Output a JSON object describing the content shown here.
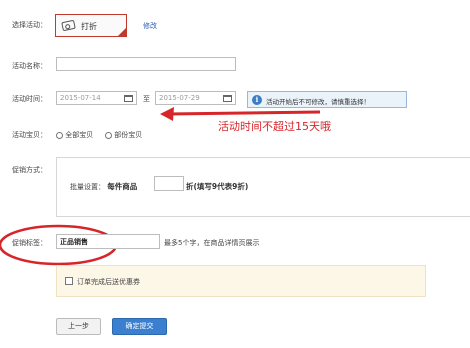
{
  "activity_type": {
    "label": "选择活动：",
    "selected": "打折",
    "modify_link": "修改"
  },
  "activity_name": {
    "label": "活动名称：",
    "value": ""
  },
  "activity_time": {
    "label": "活动时间：",
    "start": "2015-07-14",
    "separator": "至",
    "end": "2015-07-29",
    "notice": "活动开始后不可修改，请慎重选择！"
  },
  "annotation": {
    "text": "活动时间不超过15天哦",
    "color": "#d6262a"
  },
  "activity_items": {
    "label": "活动宝贝：",
    "options": [
      "全部宝贝",
      "部份宝贝"
    ]
  },
  "promotion": {
    "label": "促销方式：",
    "batch_label": "批量设置：",
    "per_item": "每件商品",
    "value": "",
    "suffix": "折(填写9代表9折)"
  },
  "promo_tag": {
    "label": "促销标签：",
    "value": "正品销售",
    "hint": "最多5个字，在商品详情页展示"
  },
  "coupon": {
    "text": "订单完成后送优惠券",
    "checked": false
  },
  "buttons": {
    "prev": "上一步",
    "submit": "确定提交"
  },
  "colors": {
    "accent_red": "#d6262a",
    "primary_blue": "#3a7fd0",
    "notice_bg": "#eaf2fa"
  }
}
